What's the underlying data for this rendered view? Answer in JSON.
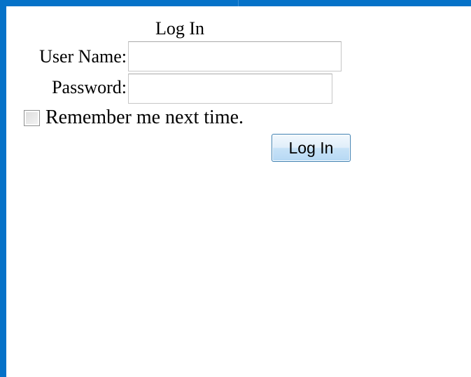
{
  "login": {
    "title": "Log In",
    "username_label": "User Name:",
    "username_value": "",
    "password_label": "Password:",
    "password_value": "",
    "remember_label": "Remember me next time.",
    "remember_checked": false,
    "submit_label": "Log In"
  },
  "colors": {
    "frame": "#0572c8",
    "button_border": "#3c7fb1",
    "button_fill": "#c7e2f7"
  }
}
